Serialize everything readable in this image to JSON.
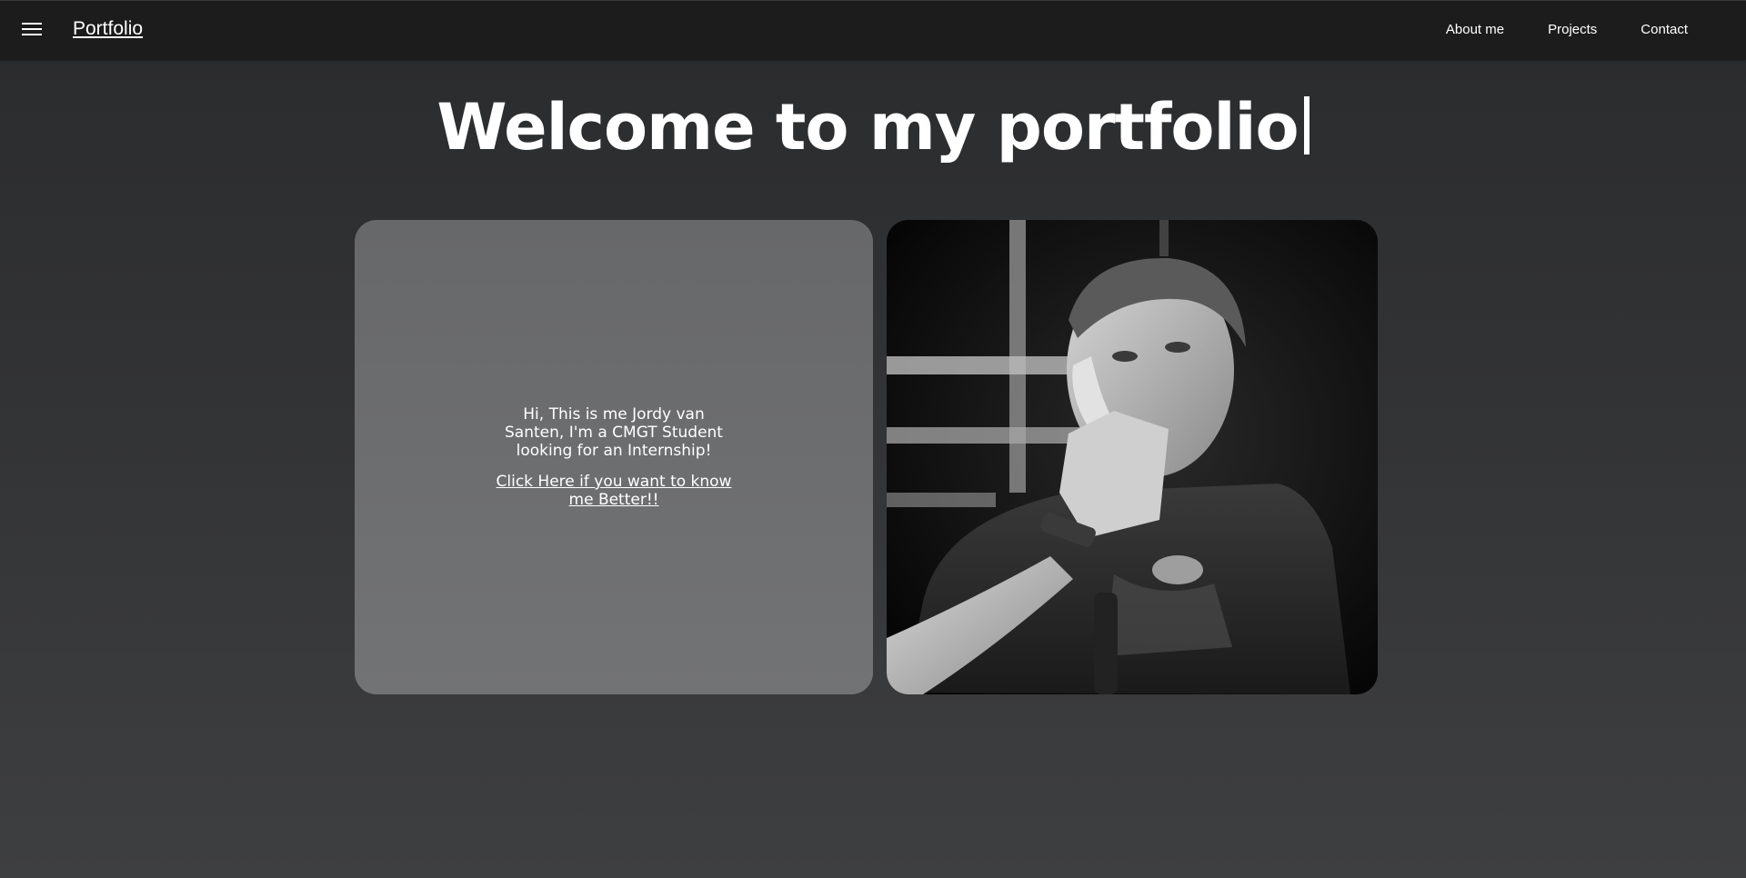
{
  "navbar": {
    "brand": "Portfolio",
    "menu_icon": "hamburger-menu-icon",
    "links": [
      "About me",
      "Projects",
      "Contact"
    ]
  },
  "hero": {
    "title": "Welcome to my portfolio"
  },
  "intro_card": {
    "text": "Hi, This is me Jordy van Santen, I'm a CMGT Student looking for an Internship!",
    "link": "Click Here if you want to know me Better!!"
  },
  "photo_card": {
    "subject": "black-and-white portrait photo"
  },
  "colors": {
    "navbar_bg": "#1c1c1c",
    "page_bg_top": "#2a2b2d",
    "page_bg_bottom": "#3e3f41",
    "card_bg": "#6d6e70",
    "text": "#ffffff"
  }
}
